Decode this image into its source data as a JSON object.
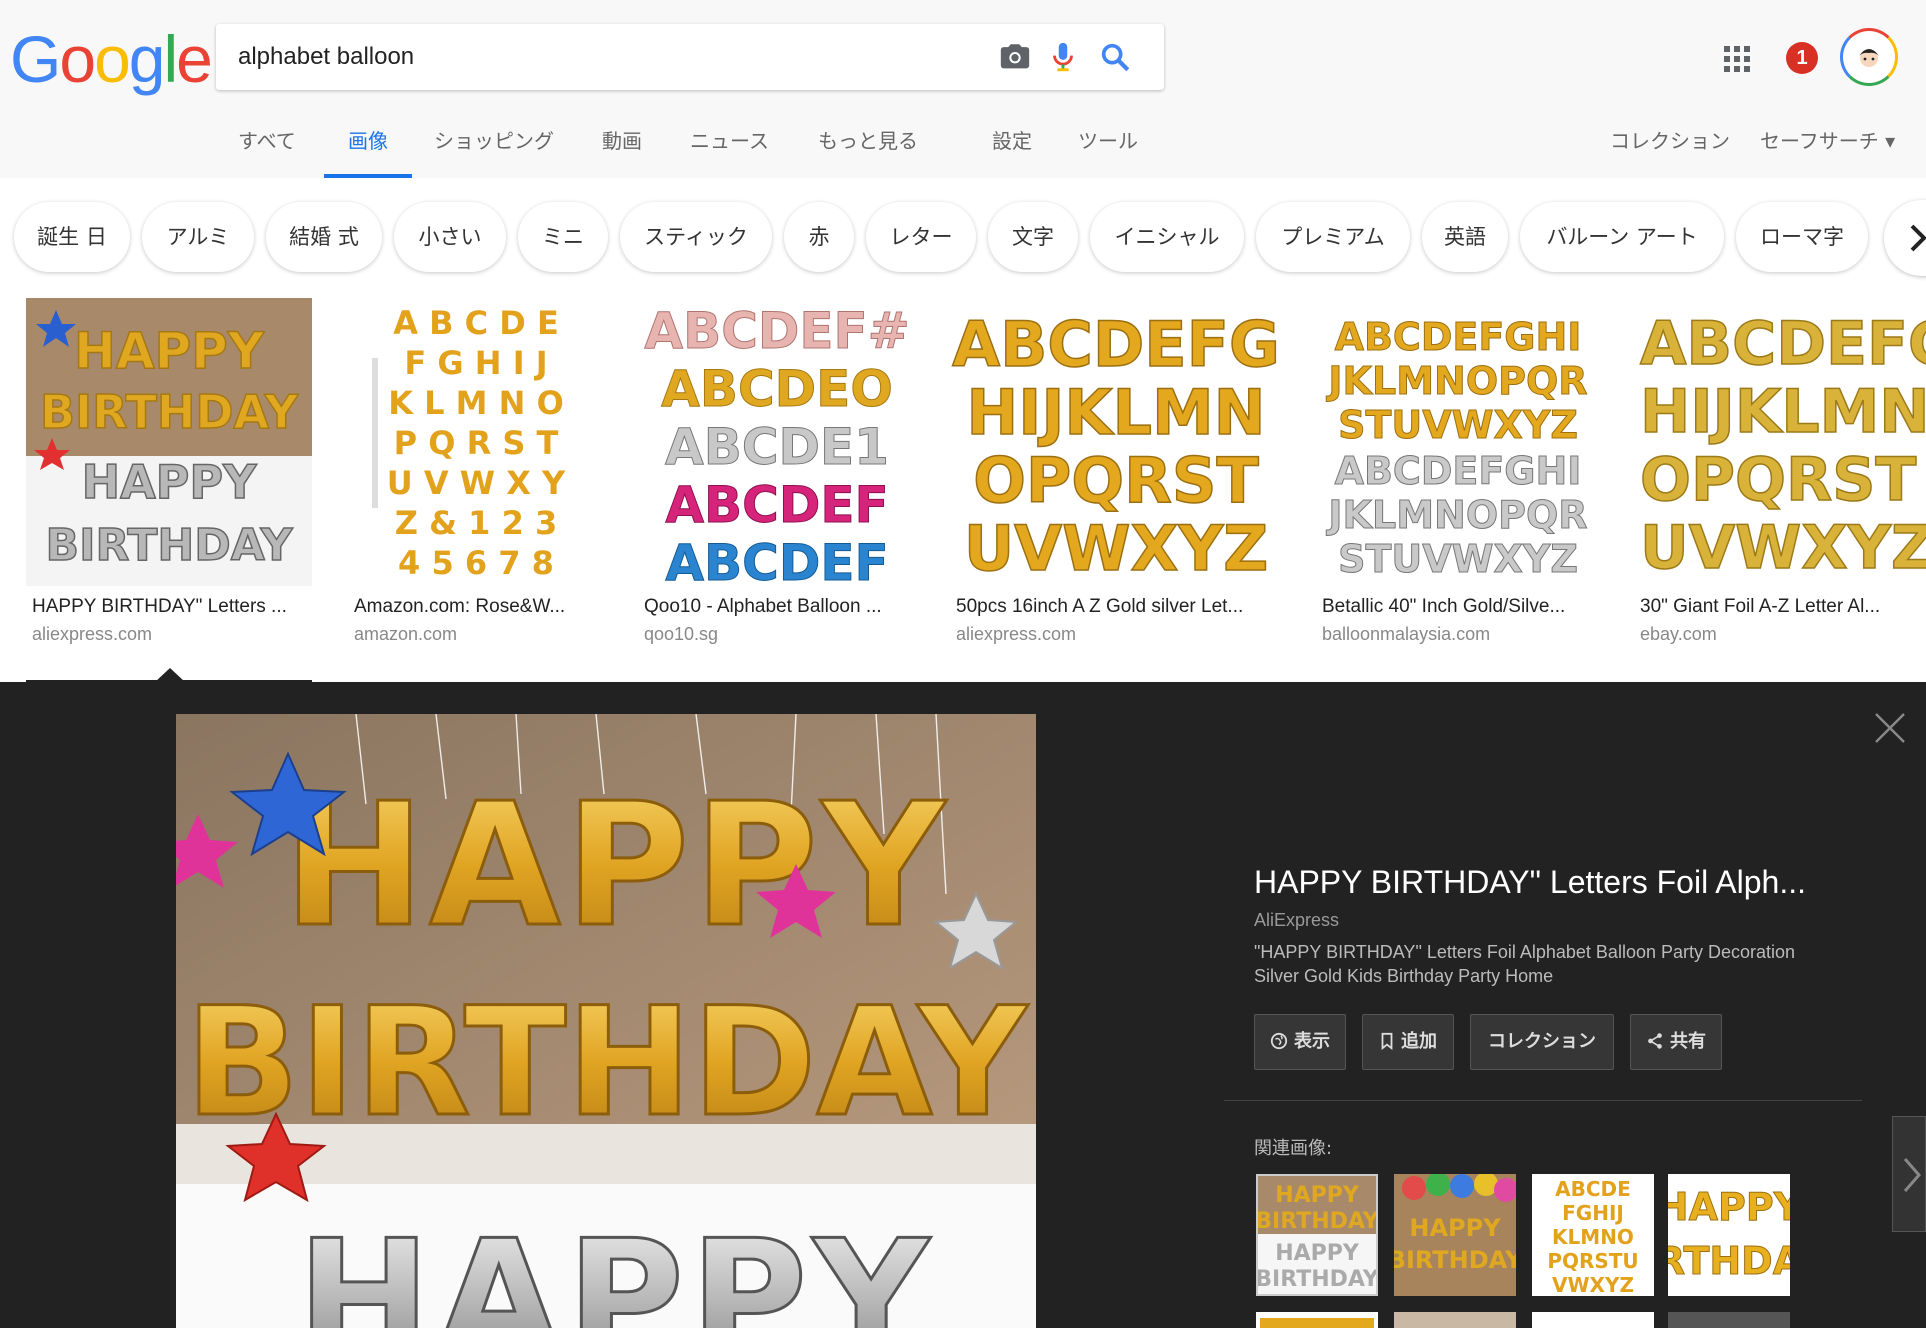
{
  "search": {
    "query": "alphabet balloon"
  },
  "logo": [
    "G",
    "o",
    "o",
    "g",
    "l",
    "e"
  ],
  "logo_colors": [
    "#4285f4",
    "#ea4335",
    "#fbbc05",
    "#4285f4",
    "#34a853",
    "#ea4335"
  ],
  "tabs": [
    "すべて",
    "画像",
    "ショッピング",
    "動画",
    "ニュース",
    "もっと見る",
    "設定",
    "ツール"
  ],
  "header_right": {
    "collection": "コレクション",
    "safesearch": "セーフサーチ ▾",
    "notifications": "1"
  },
  "chips": [
    "誕生 日",
    "アルミ",
    "結婚 式",
    "小さい",
    "ミニ",
    "スティック",
    "赤",
    "レター",
    "文字",
    "イニシャル",
    "プレミアム",
    "英語",
    "バルーン アート",
    "ローマ字"
  ],
  "results": [
    {
      "title": "HAPPY BIRTHDAY\" Letters ...",
      "domain": "aliexpress.com"
    },
    {
      "title": "Amazon.com: Rose&W...",
      "domain": "amazon.com"
    },
    {
      "title": "Qoo10 - Alphabet Balloon ...",
      "domain": "qoo10.sg"
    },
    {
      "title": "50pcs 16inch A Z Gold silver Let...",
      "domain": "aliexpress.com"
    },
    {
      "title": "Betallic 40\" Inch Gold/Silve...",
      "domain": "balloonmalaysia.com"
    },
    {
      "title": "30\" Giant Foil A-Z Letter Al...",
      "domain": "ebay.com"
    }
  ],
  "preview": {
    "title": "HAPPY BIRTHDAY\" Letters Foil Alph...",
    "source": "AliExpress",
    "description": "\"HAPPY BIRTHDAY\" Letters Foil Alphabet Balloon Party Decoration Silver Gold Kids Birthday Party Home",
    "buttons": [
      "表示",
      "追加",
      "コレクション",
      "共有"
    ],
    "related_label": "関連画像:",
    "image_text": {
      "line1": "HAPPY",
      "line2": "BIRTHDAY",
      "line3": "HAPPY"
    }
  },
  "thumb_text": {
    "t1": [
      "HAPPY",
      "BIRTHDAY",
      "HAPPY",
      "BIRTHDAY"
    ],
    "t2": [
      "A B C D E",
      "F G H I J",
      "K L M N O",
      "P Q R S T",
      "U V W X Y",
      "Z & 1 2 3",
      "4 5 6 7 8"
    ],
    "t3": [
      "ABCDEF#",
      "ABCDEO",
      "ABCDE1",
      "ABCDEF",
      "ABCDEF"
    ],
    "t4": [
      "ABCDEFG",
      "HIJKLMN",
      "OPQRST",
      "UVWXYZ"
    ],
    "t5": [
      "ABCDEFGHI",
      "JKLMNOPQR",
      "STUVWXYZ",
      "ABCDEFGHI",
      "JKLMNOPQR",
      "STUVWXYZ"
    ],
    "t6": [
      "ABCDEFG",
      "HIJKLMN",
      "OPQRST",
      "UVWXYZ"
    ]
  },
  "related_text": {
    "r1": [
      "HAPPY",
      "BIRTHDAY",
      "HAPPY",
      "BIRTHDAY"
    ],
    "r2": [
      "HAPPY",
      "BIRTHDAY"
    ],
    "r3": [
      "ABCDE",
      "FGHIJ",
      "KLMNO",
      "PQRSTU",
      "VWXYZ"
    ],
    "r4": [
      "HAPPY",
      "RTHDA"
    ]
  },
  "colors": {
    "accent": "#1a73e8",
    "gold": "#d9a520",
    "panel": "#222222"
  }
}
